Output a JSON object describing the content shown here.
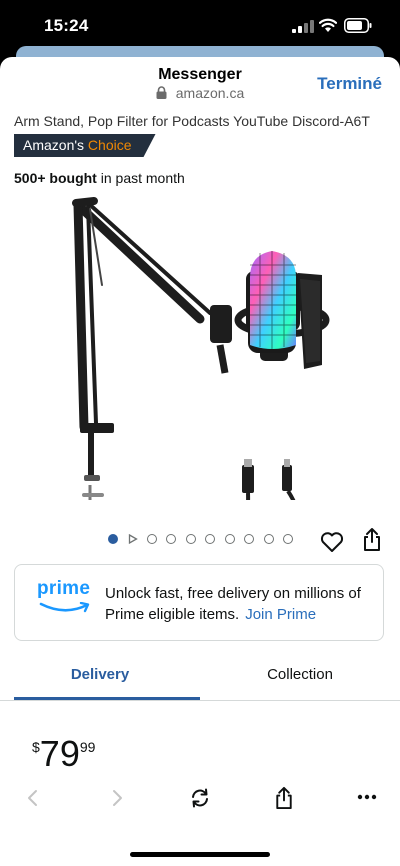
{
  "status_bar": {
    "time": "15:24"
  },
  "nav": {
    "title": "Messenger",
    "domain": "amazon.ca",
    "done_label": "Terminé"
  },
  "product": {
    "title": "Arm Stand, Pop Filter for Podcasts YouTube Discord-A6T",
    "badge_prefix": "Amazon's",
    "badge_choice": "Choice",
    "bought_count": "500+ bought",
    "bought_suffix": "in past month",
    "image_name": "microphone-arm-stand-product-image"
  },
  "carousel": {
    "count": 10,
    "active_index": 0,
    "video_index": 1
  },
  "prime": {
    "logo_text": "prime",
    "message": "Unlock fast, free delivery on millions of Prime eligible items.",
    "link": "Join Prime"
  },
  "tabs": [
    {
      "label": "Delivery",
      "active": true
    },
    {
      "label": "Collection",
      "active": false
    }
  ],
  "price": {
    "symbol": "$",
    "whole": "79",
    "fraction": "99"
  },
  "toolbar": {
    "icons": [
      "chevron-left-icon",
      "chevron-right-icon",
      "reload-icon",
      "share-icon",
      "more-icon"
    ]
  },
  "colors": {
    "accent": "#2a6ebb",
    "badge_bg": "#232f3e",
    "choice": "#f08804",
    "prime_blue": "#1a98ff",
    "tab_active": "#2a5d9f"
  }
}
